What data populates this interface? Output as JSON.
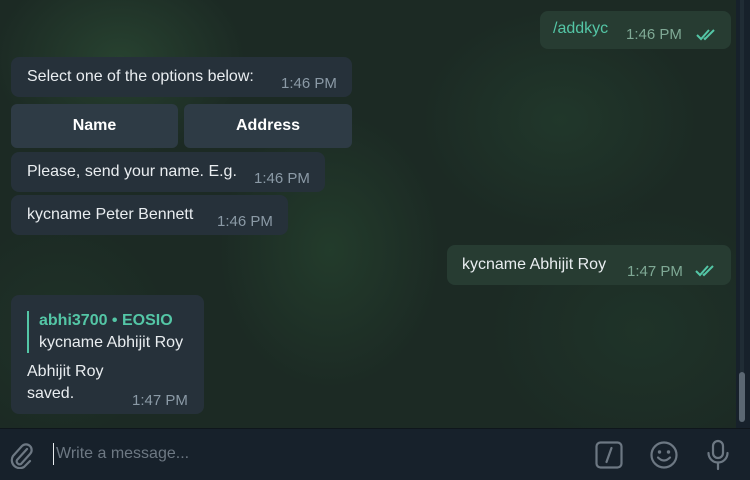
{
  "messages": {
    "m1": {
      "text": "/addkyc",
      "time": "1:46 PM"
    },
    "m2": {
      "text": "Select one of the options below:",
      "time": "1:46 PM"
    },
    "keyboard": {
      "btn1": "Name",
      "btn2": "Address"
    },
    "m3": {
      "text": "Please, send your name. E.g.",
      "time": "1:46 PM"
    },
    "m4": {
      "text": "kycname Peter Bennett",
      "time": "1:46 PM"
    },
    "m5": {
      "text": "kycname Abhijit Roy",
      "time": "1:47 PM"
    },
    "m6": {
      "reply_author": "abhi3700 • EOSIO",
      "reply_text": "kycname Abhijit Roy",
      "line1": "Abhijit Roy",
      "line2": "saved.",
      "time": "1:47 PM"
    }
  },
  "composer": {
    "placeholder": "Write a message..."
  },
  "icons": {
    "attach": "paperclip-icon",
    "commands": "slash-commands-icon",
    "emoji": "smiley-icon",
    "mic": "microphone-icon",
    "read": "double-check-icon"
  },
  "colors": {
    "accent": "#54c6a6",
    "outgoing": "#273c32",
    "incoming": "#26313a"
  }
}
